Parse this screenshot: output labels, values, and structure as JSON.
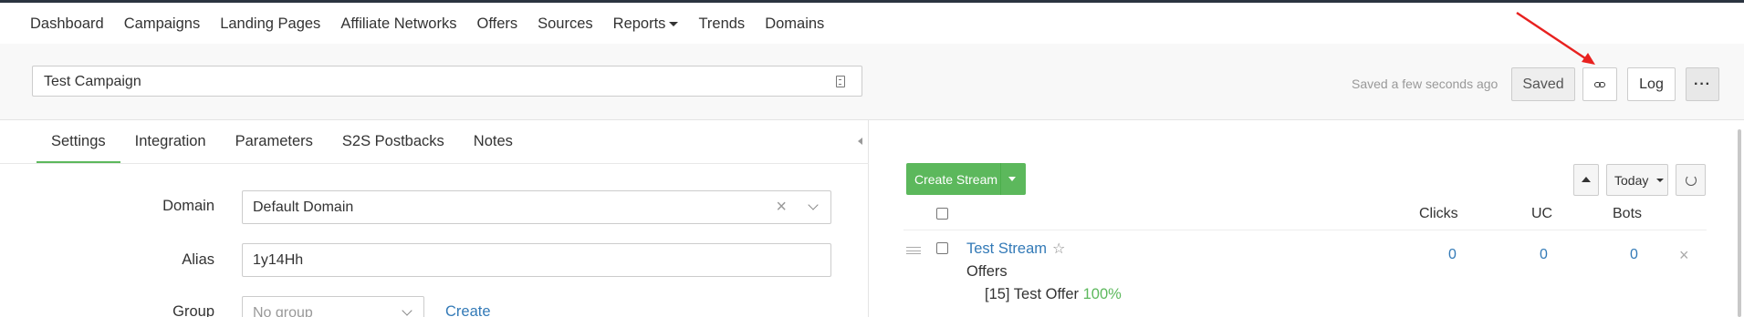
{
  "nav": {
    "items": [
      {
        "label": "Dashboard"
      },
      {
        "label": "Campaigns",
        "active": true
      },
      {
        "label": "Landing Pages"
      },
      {
        "label": "Affiliate Networks"
      },
      {
        "label": "Offers"
      },
      {
        "label": "Sources"
      },
      {
        "label": "Reports",
        "has_dropdown": true
      },
      {
        "label": "Trends"
      },
      {
        "label": "Domains"
      }
    ]
  },
  "header": {
    "campaign_name": "Test Campaign",
    "saved_status": "Saved a few seconds ago",
    "saved_button": "Saved",
    "link_button_icon": "link-icon",
    "log_button": "Log",
    "more_button": "···"
  },
  "annotation": {
    "arrow_color": "#e8211f"
  },
  "settings": {
    "tabs": [
      {
        "label": "Settings",
        "active": true
      },
      {
        "label": "Integration"
      },
      {
        "label": "Parameters"
      },
      {
        "label": "S2S Postbacks"
      },
      {
        "label": "Notes"
      }
    ],
    "domain": {
      "label": "Domain",
      "value": "Default Domain"
    },
    "alias": {
      "label": "Alias",
      "value": "1y14Hh"
    },
    "group": {
      "label": "Group",
      "placeholder": "No group",
      "create_link": "Create"
    }
  },
  "streams": {
    "create_button": "Create Stream",
    "period": "Today",
    "columns": {
      "clicks": "Clicks",
      "uc": "UC",
      "bots": "Bots"
    },
    "rows": [
      {
        "name": "Test Stream",
        "offers_label": "Offers",
        "offer": "[15] Test Offer",
        "offer_share": "100%",
        "clicks": "0",
        "uc": "0",
        "bots": "0"
      }
    ]
  },
  "colors": {
    "accent_green": "#5cb85c",
    "link_blue": "#337ab7",
    "nav_dark": "#2b3440"
  }
}
